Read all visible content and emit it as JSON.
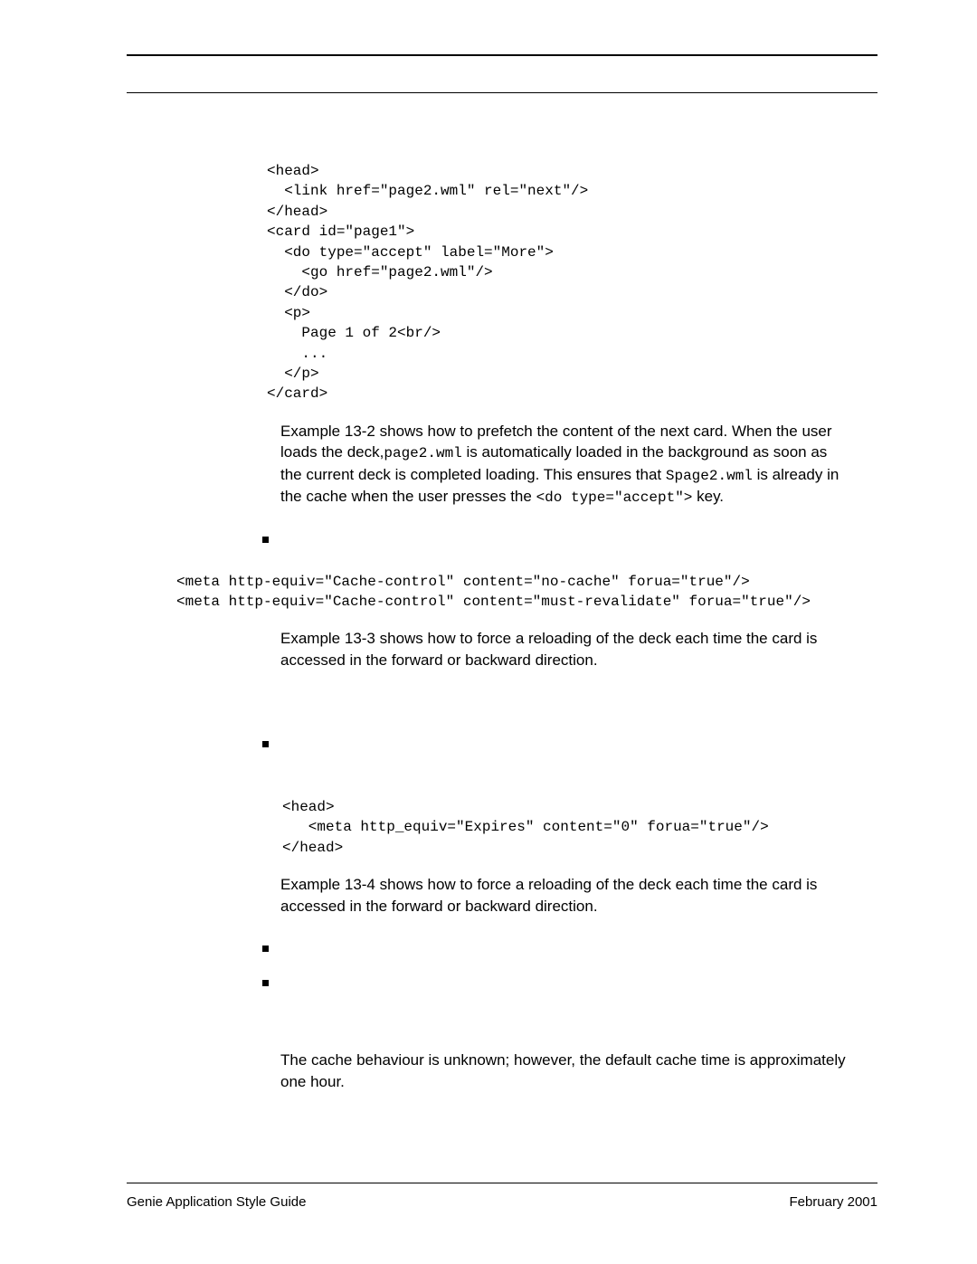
{
  "code1": "<head>\n  <link href=\"page2.wml\" rel=\"next\"/>\n</head>\n<card id=\"page1\">\n  <do type=\"accept\" label=\"More\">\n    <go href=\"page2.wml\"/>\n  </do>\n  <p>\n    Page 1 of 2<br/>\n    ...\n  </p>\n</card>",
  "para1_a": "Example 13-2 shows how to prefetch the content of the next card. When the user loads the deck,",
  "para1_mono1": "page2.wml",
  "para1_b": " is automatically loaded in the background as soon as the current deck is completed loading. This ensures that ",
  "para1_mono2": "Spage2.wml",
  "para1_c": " is already in the cache when the user presses the ",
  "para1_mono3": "<do type=\"accept\">",
  "para1_d": " key.",
  "code2": "<meta http-equiv=\"Cache-control\" content=\"no-cache\" forua=\"true\"/>\n<meta http-equiv=\"Cache-control\" content=\"must-revalidate\" forua=\"true\"/>",
  "para2": "Example 13-3 shows how to force a reloading of the deck each time the card is accessed in the forward or backward direction.",
  "code3": "<head>\n   <meta http_equiv=\"Expires\" content=\"0\" forua=\"true\"/>\n</head>",
  "para3": "Example 13-4 shows how to force a reloading of the deck each time the card is accessed in the forward or backward direction.",
  "para4": "The cache behaviour is unknown; however, the default cache time is approximately one hour.",
  "footer_left": "Genie Application Style Guide",
  "footer_right": "February 2001"
}
